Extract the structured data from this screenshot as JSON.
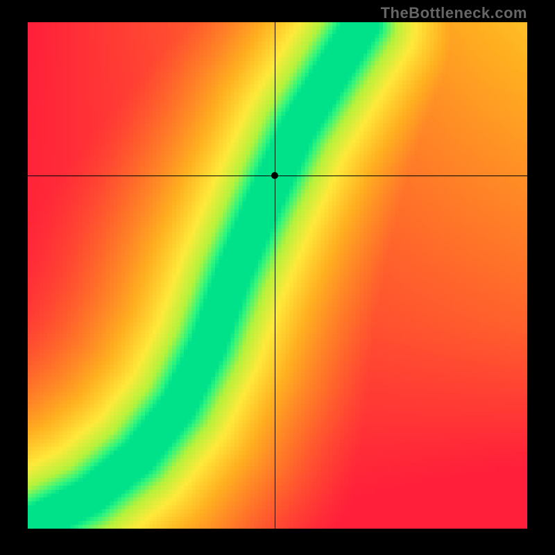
{
  "watermark": "TheBottleneck.com",
  "chart_data": {
    "type": "heatmap",
    "title": "",
    "xlabel": "",
    "ylabel": "",
    "xlim": [
      0,
      1
    ],
    "ylim": [
      0,
      1
    ],
    "grid_size": {
      "cols": 128,
      "rows": 130
    },
    "crosshair": {
      "x": 0.495,
      "y": 0.697
    },
    "color_stops": [
      {
        "t": 0.0,
        "hex": "#ff1f3a"
      },
      {
        "t": 0.25,
        "hex": "#ff6a2a"
      },
      {
        "t": 0.5,
        "hex": "#ffb020"
      },
      {
        "t": 0.7,
        "hex": "#ffe93a"
      },
      {
        "t": 0.85,
        "hex": "#b4f23c"
      },
      {
        "t": 0.95,
        "hex": "#2cf580"
      },
      {
        "t": 1.0,
        "hex": "#00e28a"
      }
    ],
    "ridge": {
      "points": [
        {
          "x": 0.0,
          "y": 0.0
        },
        {
          "x": 0.12,
          "y": 0.06
        },
        {
          "x": 0.22,
          "y": 0.14
        },
        {
          "x": 0.3,
          "y": 0.24
        },
        {
          "x": 0.36,
          "y": 0.36
        },
        {
          "x": 0.41,
          "y": 0.5
        },
        {
          "x": 0.47,
          "y": 0.64
        },
        {
          "x": 0.54,
          "y": 0.79
        },
        {
          "x": 0.62,
          "y": 0.92
        },
        {
          "x": 0.67,
          "y": 1.0
        }
      ],
      "half_width": 0.035,
      "falloff": 0.45
    },
    "background_gradient": {
      "bottom_right": 0.0,
      "bottom_left": 0.05,
      "top_left": 0.0,
      "top_right": 0.55
    }
  }
}
